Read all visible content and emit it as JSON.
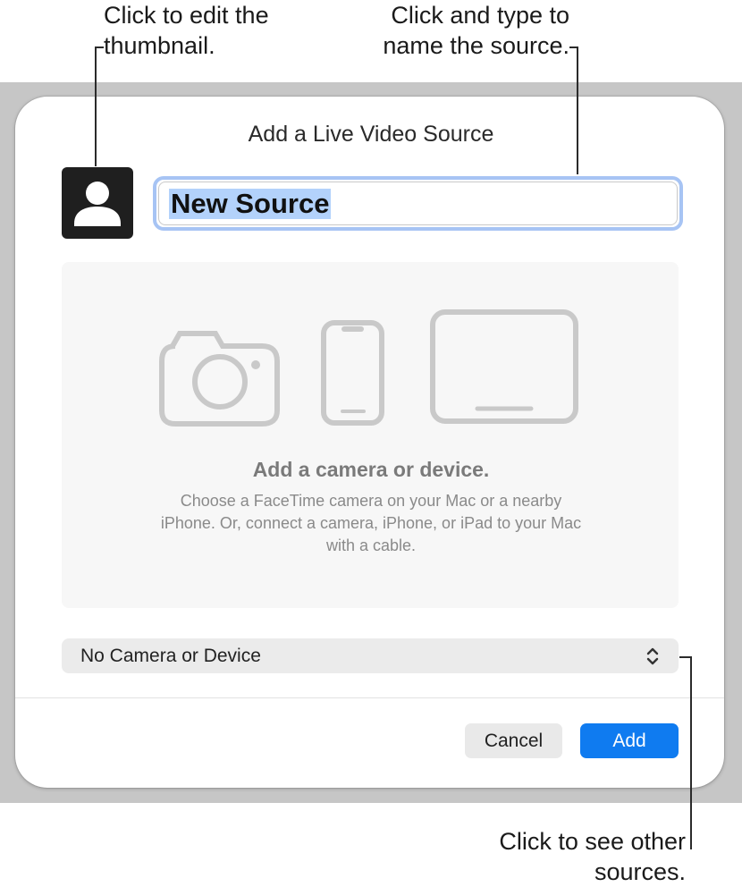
{
  "callouts": {
    "thumbnail": [
      "Click to edit the",
      "thumbnail."
    ],
    "name": [
      "Click and type to",
      "name the source."
    ],
    "sources": [
      "Click to see other",
      "sources."
    ]
  },
  "dialog": {
    "title": "Add a Live Video Source",
    "thumbnail_icon": "person-icon",
    "name_field_value": "New Source",
    "device_area": {
      "icons": [
        "camera-icon",
        "iphone-icon",
        "ipad-icon"
      ],
      "heading": "Add a camera or device.",
      "description": [
        "Choose a FaceTime camera on your Mac or a nearby",
        "iPhone. Or, connect a camera, iPhone, or iPad to your Mac",
        "with a cable."
      ]
    },
    "source_popup": {
      "selected": "No Camera or Device",
      "icon": "chevron-up-down-icon"
    },
    "buttons": {
      "cancel": "Cancel",
      "add": "Add"
    }
  },
  "colors": {
    "accent": "#0f7bf0",
    "focus_ring": "#a7c4f4",
    "selection": "#b3d2fb",
    "backdrop": "#c6c6c6"
  }
}
